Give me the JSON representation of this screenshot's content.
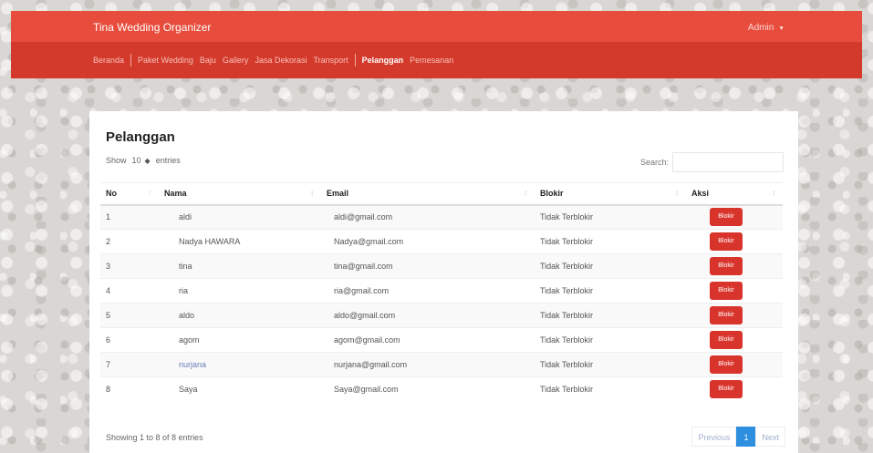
{
  "header": {
    "brand": "Tina Wedding Organizer",
    "user_menu": "Admin",
    "user_caret": "▼"
  },
  "nav": {
    "items": [
      {
        "label": "Beranda",
        "active": false
      },
      {
        "label": "Paket Wedding",
        "active": false
      },
      {
        "label": "Baju",
        "active": false
      },
      {
        "label": "Gallery",
        "active": false
      },
      {
        "label": "Jasa Dekorasi",
        "active": false
      },
      {
        "label": "Transport",
        "active": false
      },
      {
        "label": "Pelanggan",
        "active": true
      },
      {
        "label": "Pemesanan",
        "active": false
      }
    ]
  },
  "panel": {
    "title": "Pelanggan",
    "length": {
      "show_label": "Show",
      "value": "10",
      "entries_label": "entries"
    },
    "search": {
      "label": "Search:",
      "value": "",
      "placeholder": ""
    }
  },
  "table": {
    "columns": [
      "No",
      "Nama",
      "Email",
      "Blokir",
      "Aksi"
    ],
    "rows": [
      {
        "no": "1",
        "nama": "aldi",
        "email": "aldi@gmail.com",
        "blokir": "Tidak Terblokir",
        "aksi": "Blokir"
      },
      {
        "no": "2",
        "nama": "Nadya HAWARA",
        "email": "Nadya@gmail.com",
        "blokir": "Tidak Terblokir",
        "aksi": "Blokir"
      },
      {
        "no": "3",
        "nama": "tina",
        "email": "tina@gmail.com",
        "blokir": "Tidak Terblokir",
        "aksi": "Blokir"
      },
      {
        "no": "4",
        "nama": "ria",
        "email": "ria@gmail.com",
        "blokir": "Tidak Terblokir",
        "aksi": "Blokir"
      },
      {
        "no": "5",
        "nama": "aldo",
        "email": "aldo@gmail.com",
        "blokir": "Tidak Terblokir",
        "aksi": "Blokir"
      },
      {
        "no": "6",
        "nama": "agom",
        "email": "agom@gmail.com",
        "blokir": "Tidak Terblokir",
        "aksi": "Blokir"
      },
      {
        "no": "7",
        "nama": "nurjana",
        "email": "nurjana@gmail.com",
        "blokir": "Tidak Terblokir",
        "aksi": "Blokir"
      },
      {
        "no": "8",
        "nama": "Saya",
        "email": "Saya@gmail.com",
        "blokir": "Tidak Terblokir",
        "aksi": "Blokir"
      }
    ]
  },
  "footer": {
    "info": "Showing 1 to 8 of 8 entries",
    "pagination": {
      "previous": "Previous",
      "current": "1",
      "next": "Next"
    }
  },
  "icons": {
    "sort": "↕",
    "sort_asc": "↑",
    "select_arrow": "◆"
  },
  "colors": {
    "topbar": "#e74c3c",
    "navbar": "#d43a2c",
    "block_button": "#d9342b",
    "page_active": "#2e8ee0"
  }
}
